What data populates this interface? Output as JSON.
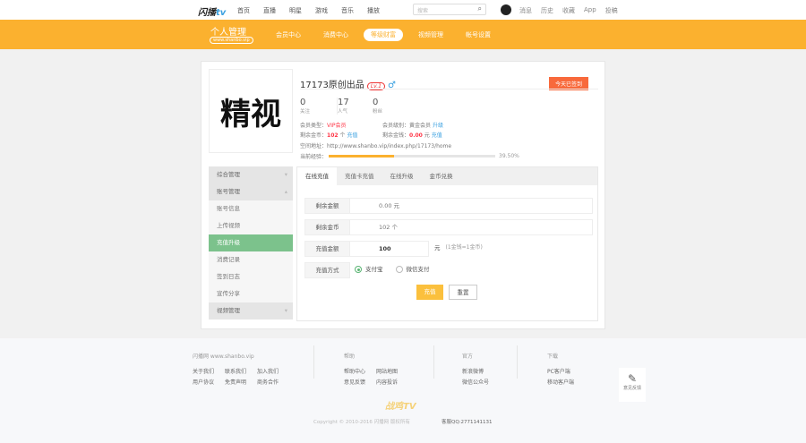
{
  "topbar": {
    "logo": "闪播tv",
    "nav": [
      "首页",
      "直播",
      "明星",
      "游戏",
      "音乐",
      "播放"
    ],
    "search_placeholder": "搜索",
    "right": [
      "消息",
      "历史",
      "收藏",
      "App",
      "投稿"
    ]
  },
  "header": {
    "title": "个人管理",
    "subtitle": "www.shanbo.vip",
    "nav": [
      "会员中心",
      "消费中心",
      "等级财富",
      "视频管理",
      "帐号设置"
    ],
    "active_nav": "等级财富"
  },
  "profile": {
    "logo_text": "精视",
    "name": "17173原创出品",
    "level": "Lv.1",
    "gender": "♂",
    "sign_button": "今天已签到",
    "stats": [
      {
        "n": "0",
        "l": "关注"
      },
      {
        "n": "17",
        "l": "人气"
      },
      {
        "n": "0",
        "l": "粉丝"
      }
    ],
    "member_type_label": "会员类型：",
    "member_type": "VIP会员",
    "member_level_label": "会员级别：",
    "member_level": "黄金会员",
    "upgrade": "升级",
    "coins_label": "剩余金币：",
    "coins": "102",
    "coins_unit": "个",
    "recharge": "充值",
    "money_label": "剩余金钱：",
    "money": "0.00",
    "money_unit": "元",
    "recharge2": "充值",
    "space_label": "空间地址：",
    "space_url": "http://www.shanbo.vip/index.php/17173/home",
    "exp_label": "当前经验：",
    "exp_percent": 39.5,
    "exp_text": "39.50%"
  },
  "sidebar": [
    {
      "label": "综合管理",
      "type": "group"
    },
    {
      "label": "账号管理",
      "type": "group-open"
    },
    {
      "label": "账号信息"
    },
    {
      "label": "上传视频"
    },
    {
      "label": "充值升级",
      "active": true
    },
    {
      "label": "消费记录"
    },
    {
      "label": "签到日志"
    },
    {
      "label": "宣传分享"
    },
    {
      "label": "视频管理",
      "type": "group"
    }
  ],
  "tabs": [
    "在线充值",
    "充值卡充值",
    "在线升级",
    "金币兑换"
  ],
  "form": {
    "balance_label": "剩余金额",
    "balance": "0.00 元",
    "coins_label": "剩余金币",
    "coins": "102 个",
    "amount_label": "充值金额",
    "amount": "100",
    "amount_unit": "元",
    "rate": "(1金钱=1金币)",
    "method_label": "充值方式",
    "methods": [
      "支付宝",
      "微信支付"
    ],
    "submit": "充值",
    "reset": "重置"
  },
  "footer": {
    "site": "闪播网 www.shanbo.vip",
    "links1": [
      "关于我们",
      "联系我们",
      "加入我们",
      "用户协议",
      "免责声明",
      "商务合作"
    ],
    "help_title": "帮助",
    "help": [
      "帮助中心",
      "网站地图",
      "意见反馈",
      "内容投诉"
    ],
    "official_title": "官方",
    "official": [
      "新浪微博",
      "微信公众号"
    ],
    "download_title": "下载",
    "download": [
      "PC客户端",
      "移动客户端"
    ],
    "feedback": "意见反馈",
    "logo": "战鸡TV",
    "copyright": "Copyright © 2010-2016 闪播网 版权所有",
    "qq": "客服QQ:2771141131"
  }
}
